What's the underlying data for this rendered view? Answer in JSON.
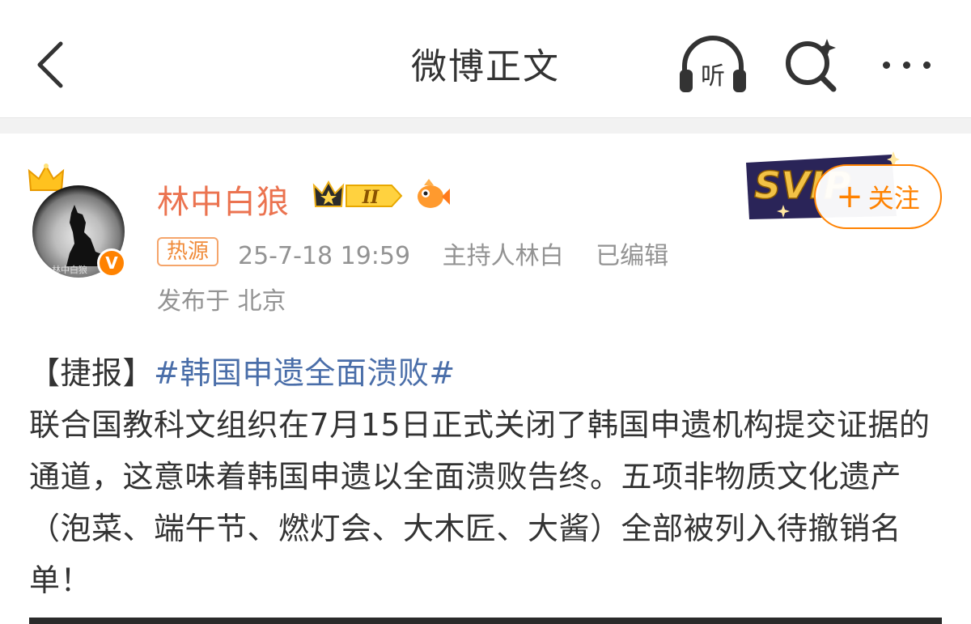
{
  "nav": {
    "title": "微博正文",
    "listen_label": "听"
  },
  "post": {
    "author": {
      "name": "林中白狼",
      "vip_level": "II",
      "avatar_signature": "林中白狼",
      "verified_mark": "V"
    },
    "follow_button": {
      "plus": "+",
      "label": "关注"
    },
    "svip_label": "SVIP",
    "source_tag": "热源",
    "timestamp": "25-7-18 19:59",
    "host": "主持人林白",
    "edited": "已编辑",
    "location": "发布于 北京",
    "content": {
      "prefix": "【捷报】",
      "hashtag": "#韩国申遗全面溃败#",
      "text": "联合国教科文组织在7月15日正式关闭了韩国申遗机构提交证据的通道，这意味着韩国申遗以全面溃败告终。五项非物质文化遗产（泡菜、端午节、燃灯会、大木匠、大酱）全部被列入待撤销名单！"
    }
  },
  "colors": {
    "accent": "#ff8200",
    "username": "#eb7350",
    "hashtag": "#4a6ea9",
    "meta": "#939393"
  }
}
